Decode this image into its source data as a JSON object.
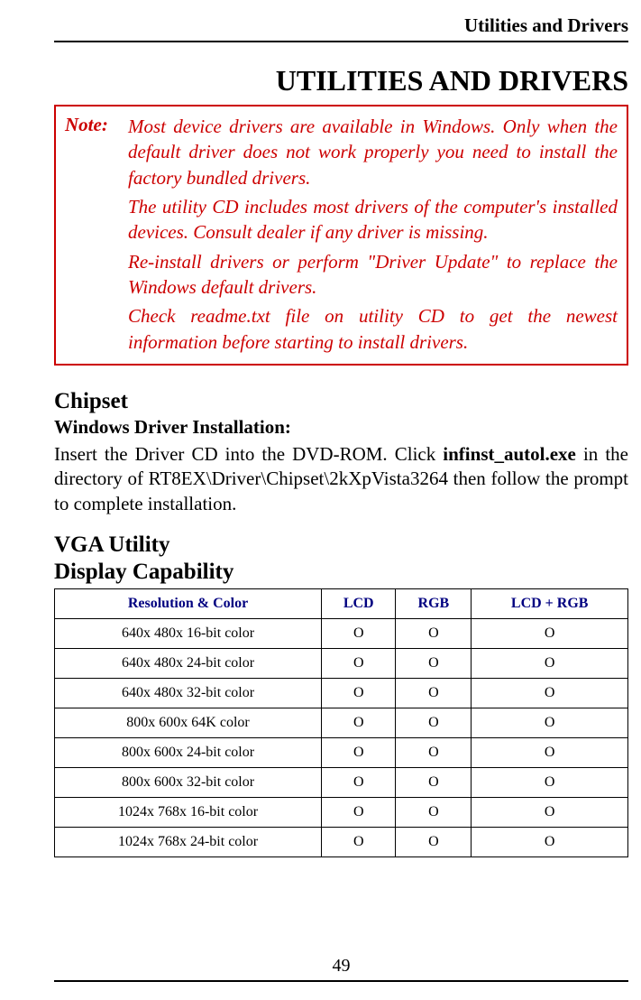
{
  "header": {
    "title": "Utilities and Drivers"
  },
  "main_title": "UTILITIES AND DRIVERS",
  "note": {
    "label": "Note:",
    "paragraphs": [
      "Most device drivers are available in Windows. Only when the default driver does not work properly you need to install the factory bundled drivers.",
      "The utility CD includes most drivers of the computer's installed devices. Consult dealer if any driver is missing.",
      "Re-install drivers or perform \"Driver Update\" to replace the Windows default drivers.",
      "Check readme.txt file on utility CD to get the newest information before starting to install drivers."
    ]
  },
  "chipset": {
    "heading": "Chipset",
    "sub_heading": "Windows Driver Installation:",
    "body_prefix": "Insert the Driver CD into the DVD-ROM. Click ",
    "body_bold": "infinst_autol.exe",
    "body_suffix": " in the directory of RT8EX\\Driver\\Chipset\\2kXpVista3264 then follow the prompt to complete installation."
  },
  "vga": {
    "heading": "VGA Utility",
    "sub_heading": "Display Capability"
  },
  "table": {
    "headers": [
      "Resolution & Color",
      "LCD",
      "RGB",
      "LCD + RGB"
    ],
    "rows": [
      [
        "640x 480x 16-bit color",
        "O",
        "O",
        "O"
      ],
      [
        "640x 480x 24-bit color",
        "O",
        "O",
        "O"
      ],
      [
        "640x 480x 32-bit color",
        "O",
        "O",
        "O"
      ],
      [
        "800x 600x 64K color",
        "O",
        "O",
        "O"
      ],
      [
        "800x 600x 24-bit color",
        "O",
        "O",
        "O"
      ],
      [
        "800x 600x 32-bit color",
        "O",
        "O",
        "O"
      ],
      [
        "1024x 768x 16-bit color",
        "O",
        "O",
        "O"
      ],
      [
        "1024x 768x 24-bit color",
        "O",
        "O",
        "O"
      ]
    ]
  },
  "page_number": "49"
}
